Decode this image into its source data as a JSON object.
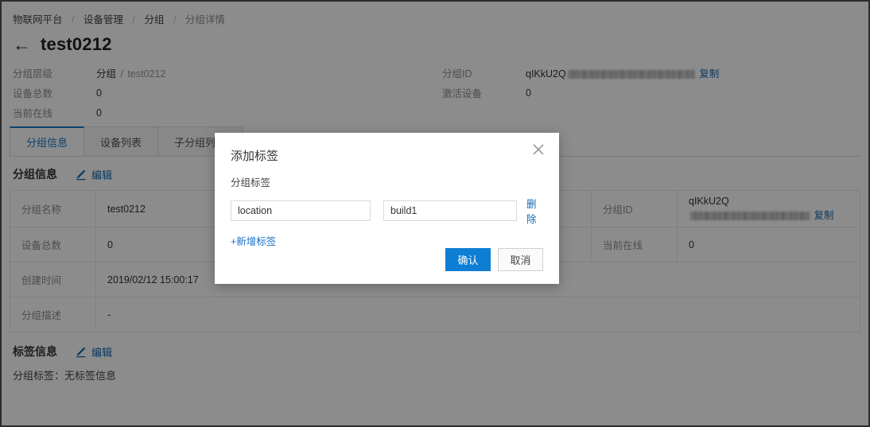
{
  "breadcrumb": {
    "items": [
      "物联网平台",
      "设备管理",
      "分组",
      "分组详情"
    ],
    "separator": "/"
  },
  "header": {
    "back_icon": "arrow-left-icon",
    "title": "test0212"
  },
  "summary": {
    "left": [
      {
        "label": "分组层级",
        "value": "分组",
        "sub_sep": "/",
        "sub": "test0212"
      },
      {
        "label": "设备总数",
        "value": "0"
      },
      {
        "label": "当前在线",
        "value": "0"
      }
    ],
    "right": [
      {
        "label": "分组ID",
        "value": "qIKkU2Q",
        "redacted": true,
        "action": "复制"
      },
      {
        "label": "激活设备",
        "value": "0"
      }
    ]
  },
  "tabs": [
    {
      "label": "分组信息",
      "active": true
    },
    {
      "label": "设备列表",
      "active": false
    },
    {
      "label": "子分组列表",
      "active": false
    }
  ],
  "group_section": {
    "title": "分组信息",
    "edit_label": "编辑",
    "edit_icon": "pencil-icon"
  },
  "info_table": {
    "rows": [
      {
        "k": "分组名称",
        "v": "test0212",
        "k2": "分组ID",
        "v2": "qIKkU2Q",
        "v2_redacted": true,
        "v2_action": "复制"
      },
      {
        "k": "设备总数",
        "v": "0",
        "k2": "当前在线",
        "v2": "0"
      },
      {
        "k": "创建时间",
        "v": "2019/02/12 15:00:17",
        "k2": "",
        "v2": ""
      },
      {
        "k": "分组描述",
        "v": "-",
        "k2": "",
        "v2": ""
      }
    ]
  },
  "tag_section": {
    "title": "标签信息",
    "edit_label": "编辑",
    "edit_icon": "pencil-icon",
    "tags_text": "分组标签：无标签信息"
  },
  "modal": {
    "title": "添加标签",
    "close_icon": "close-icon",
    "field_label": "分组标签",
    "tag_rows": [
      {
        "key_value": "location",
        "key_placeholder": "",
        "value_value": "build1",
        "value_placeholder": "",
        "delete_label": "删除"
      }
    ],
    "add_label": "+新增标签",
    "confirm_label": "确认",
    "cancel_label": "取消"
  },
  "colors": {
    "primary": "#0d7ed4",
    "link": "#1367b0",
    "tab_active": "#1678c8",
    "overlay": "rgba(0,0,0,0.45)",
    "border": "#e3e3e3"
  }
}
